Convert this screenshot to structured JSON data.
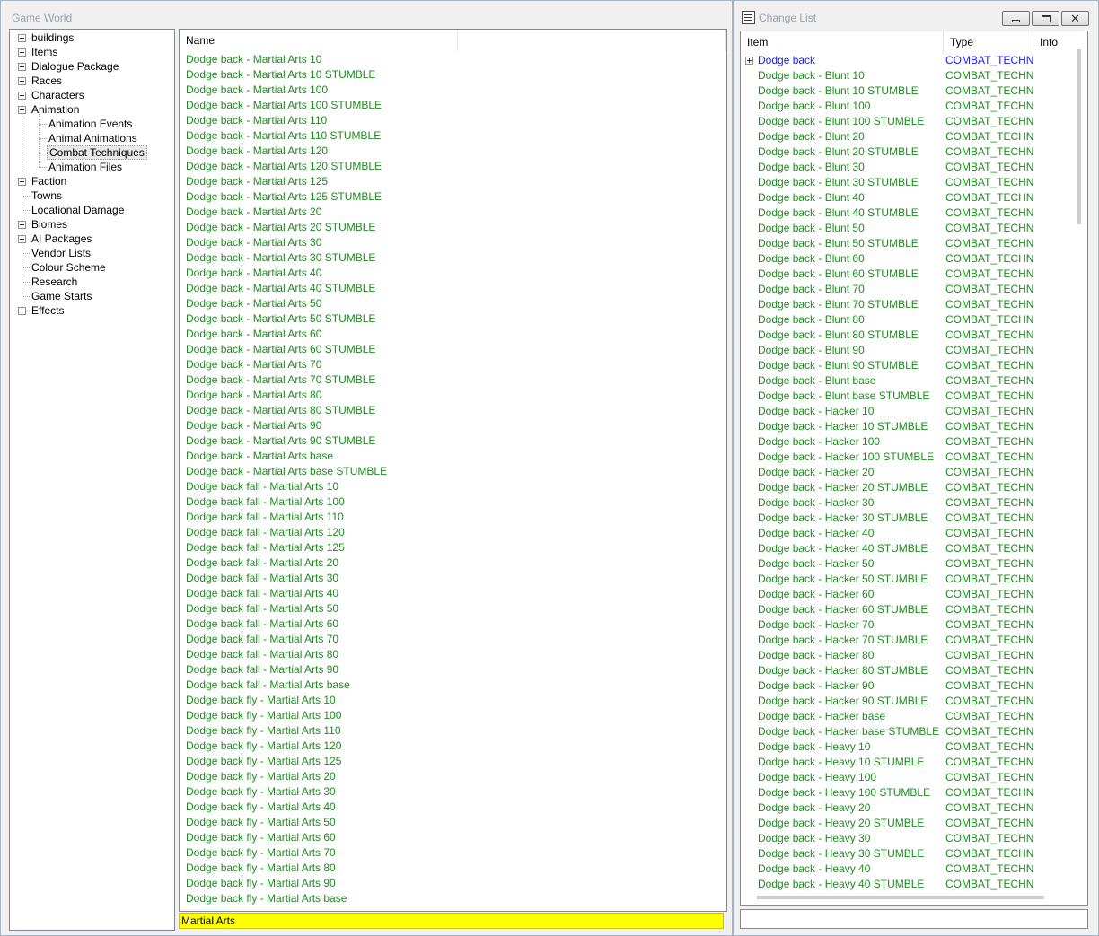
{
  "game_world": {
    "title": "Game World",
    "tree": [
      {
        "label": "buildings",
        "expander": "plus"
      },
      {
        "label": "Items",
        "expander": "plus"
      },
      {
        "label": "Dialogue Package",
        "expander": "plus"
      },
      {
        "label": "Races",
        "expander": "plus"
      },
      {
        "label": "Characters",
        "expander": "plus"
      },
      {
        "label": "Animation",
        "expander": "minus"
      },
      {
        "label": "Animation Events",
        "child": true
      },
      {
        "label": "Animal Animations",
        "child": true
      },
      {
        "label": "Combat Techniques",
        "child": true,
        "selected": true
      },
      {
        "label": "Animation Files",
        "child": true
      },
      {
        "label": "Faction",
        "expander": "plus"
      },
      {
        "label": "Towns",
        "expander": "none"
      },
      {
        "label": "Locational Damage",
        "expander": "none"
      },
      {
        "label": "Biomes",
        "expander": "plus"
      },
      {
        "label": "AI Packages",
        "expander": "plus"
      },
      {
        "label": "Vendor Lists",
        "expander": "none"
      },
      {
        "label": "Colour Scheme",
        "expander": "none"
      },
      {
        "label": "Research",
        "expander": "none"
      },
      {
        "label": "Game Starts",
        "expander": "none"
      },
      {
        "label": "Effects",
        "expander": "plus"
      }
    ],
    "list_header": "Name",
    "items": [
      "Dodge back - Martial Arts 10",
      "Dodge back - Martial Arts 10 STUMBLE",
      "Dodge back - Martial Arts 100",
      "Dodge back - Martial Arts 100 STUMBLE",
      "Dodge back - Martial Arts 110",
      "Dodge back - Martial Arts 110 STUMBLE",
      "Dodge back - Martial Arts 120",
      "Dodge back - Martial Arts 120 STUMBLE",
      "Dodge back - Martial Arts 125",
      "Dodge back - Martial Arts 125 STUMBLE",
      "Dodge back - Martial Arts 20",
      "Dodge back - Martial Arts 20 STUMBLE",
      "Dodge back - Martial Arts 30",
      "Dodge back - Martial Arts 30 STUMBLE",
      "Dodge back - Martial Arts 40",
      "Dodge back - Martial Arts 40 STUMBLE",
      "Dodge back - Martial Arts 50",
      "Dodge back - Martial Arts 50  STUMBLE",
      "Dodge back - Martial Arts 60",
      "Dodge back - Martial Arts 60 STUMBLE",
      "Dodge back - Martial Arts 70",
      "Dodge back - Martial Arts 70  STUMBLE",
      "Dodge back - Martial Arts 80",
      "Dodge back - Martial Arts 80 STUMBLE",
      "Dodge back - Martial Arts 90",
      "Dodge back - Martial Arts 90 STUMBLE",
      "Dodge back - Martial Arts base",
      "Dodge back - Martial Arts base STUMBLE",
      "Dodge back fall - Martial Arts 10",
      "Dodge back fall - Martial Arts 100",
      "Dodge back fall - Martial Arts 110",
      "Dodge back fall - Martial Arts 120",
      "Dodge back fall - Martial Arts 125",
      "Dodge back fall - Martial Arts 20",
      "Dodge back fall - Martial Arts 30",
      "Dodge back fall - Martial Arts 40",
      "Dodge back fall - Martial Arts 50",
      "Dodge back fall - Martial Arts 60",
      "Dodge back fall - Martial Arts 70",
      "Dodge back fall - Martial Arts 80",
      "Dodge back fall - Martial Arts 90",
      "Dodge back fall - Martial Arts base",
      "Dodge back fly - Martial Arts 10",
      "Dodge back fly - Martial Arts 100",
      "Dodge back fly - Martial Arts 110",
      "Dodge back fly - Martial Arts 120",
      "Dodge back fly - Martial Arts 125",
      "Dodge back fly - Martial Arts 20",
      "Dodge back fly - Martial Arts 30",
      "Dodge back fly - Martial Arts 40",
      "Dodge back fly - Martial Arts 50",
      "Dodge back fly - Martial Arts 60",
      "Dodge back fly - Martial Arts 70",
      "Dodge back fly - Martial Arts 80",
      "Dodge back fly - Martial Arts 90",
      "Dodge back fly - Martial Arts base"
    ],
    "filter_value": "Martial Arts"
  },
  "change_list": {
    "title": "Change List",
    "columns": {
      "item": "Item",
      "type": "Type",
      "info": "Info"
    },
    "parent_row": {
      "item": "Dodge back",
      "type": "COMBAT_TECHNIQ"
    },
    "type_value": "COMBAT_TECHNIQ",
    "rows": [
      "Dodge back - Blunt 10",
      "Dodge back - Blunt 10 STUMBLE",
      "Dodge back - Blunt 100",
      "Dodge back - Blunt 100 STUMBLE",
      "Dodge back - Blunt 20",
      "Dodge back - Blunt 20 STUMBLE",
      "Dodge back - Blunt 30",
      "Dodge back - Blunt 30 STUMBLE",
      "Dodge back - Blunt 40",
      "Dodge back - Blunt 40 STUMBLE",
      "Dodge back - Blunt 50",
      "Dodge back - Blunt 50 STUMBLE",
      "Dodge back - Blunt 60",
      "Dodge back - Blunt 60 STUMBLE",
      "Dodge back - Blunt 70",
      "Dodge back - Blunt 70 STUMBLE",
      "Dodge back - Blunt 80",
      "Dodge back - Blunt 80 STUMBLE",
      "Dodge back - Blunt 90",
      "Dodge back - Blunt 90 STUMBLE",
      "Dodge back - Blunt base",
      "Dodge back - Blunt base STUMBLE",
      "Dodge back - Hacker 10",
      "Dodge back - Hacker 10 STUMBLE",
      "Dodge back - Hacker 100",
      "Dodge back - Hacker 100 STUMBLE",
      "Dodge back - Hacker 20",
      "Dodge back - Hacker 20 STUMBLE",
      "Dodge back - Hacker 30",
      "Dodge back - Hacker 30 STUMBLE",
      "Dodge back - Hacker 40",
      "Dodge back - Hacker 40 STUMBLE",
      "Dodge back - Hacker 50",
      "Dodge back - Hacker 50 STUMBLE",
      "Dodge back - Hacker 60",
      "Dodge back - Hacker 60 STUMBLE",
      "Dodge back - Hacker 70",
      "Dodge back - Hacker 70 STUMBLE",
      "Dodge back - Hacker 80",
      "Dodge back - Hacker 80 STUMBLE",
      "Dodge back - Hacker 90",
      "Dodge back - Hacker 90 STUMBLE",
      "Dodge back - Hacker base",
      "Dodge back - Hacker base STUMBLE",
      "Dodge back - Heavy 10",
      "Dodge back - Heavy 10 STUMBLE",
      "Dodge back - Heavy 100",
      "Dodge back - Heavy 100 STUMBLE",
      "Dodge back - Heavy 20",
      "Dodge back - Heavy 20 STUMBLE",
      "Dodge back - Heavy 30",
      "Dodge back - Heavy 30 STUMBLE",
      "Dodge back - Heavy 40",
      "Dodge back - Heavy 40 STUMBLE"
    ]
  },
  "colors": {
    "item_green": "#1e8c1e",
    "parent_blue": "#1a1aff",
    "filter_yellow": "#ffff00"
  },
  "icons": {
    "window_icon": "list-window-icon",
    "minimize": "minimize-icon",
    "maximize": "maximize-icon",
    "close": "close-icon",
    "expand": "plus-expander-icon",
    "collapse": "minus-expander-icon"
  }
}
